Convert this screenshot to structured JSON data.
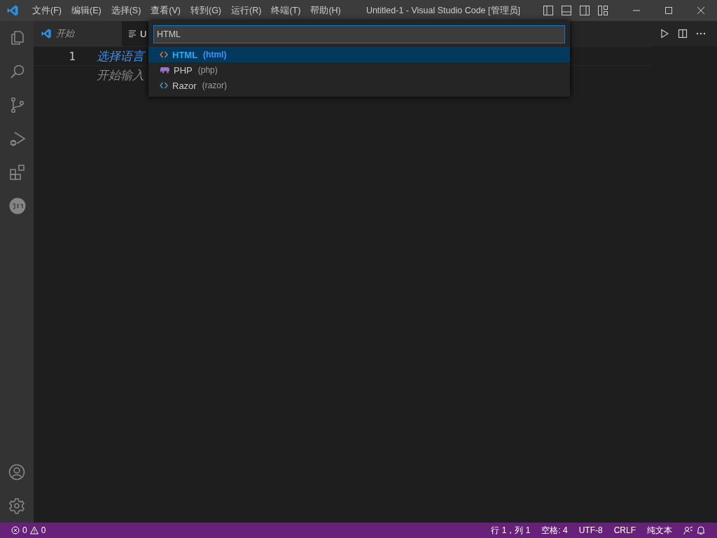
{
  "window": {
    "title": "Untitled-1 - Visual Studio Code [管理员]"
  },
  "menu": [
    "文件(F)",
    "编辑(E)",
    "选择(S)",
    "查看(V)",
    "转到(G)",
    "运行(R)",
    "终端(T)",
    "帮助(H)"
  ],
  "activity_bar": [
    {
      "kind": "explorer",
      "selected": false
    },
    {
      "kind": "search",
      "selected": false
    },
    {
      "kind": "source-control",
      "selected": false
    },
    {
      "kind": "debug",
      "selected": false
    },
    {
      "kind": "extensions",
      "selected": false
    },
    {
      "kind": "json",
      "selected": false
    }
  ],
  "tabs": [
    {
      "label": "开始",
      "kind": "welcome",
      "selected": false
    },
    {
      "label": "U",
      "kind": "file",
      "selected": true
    }
  ],
  "editor": {
    "lines": [
      {
        "number": "1",
        "text": "选择语言",
        "kind": "hint"
      },
      {
        "text": "开始输入",
        "kind": "muted"
      }
    ]
  },
  "quick_pick": {
    "value": "HTML",
    "items": [
      {
        "label": "HTML",
        "id": "(html)",
        "kind": "html",
        "selected": true
      },
      {
        "label": "PHP",
        "id": "(php)",
        "kind": "php",
        "selected": false
      },
      {
        "label": "Razor",
        "id": "(razor)",
        "kind": "razor",
        "selected": false
      }
    ]
  },
  "status_bar": {
    "errors": "0",
    "warnings": "0",
    "right": [
      "行 1，列 1",
      "空格: 4",
      "UTF-8",
      "CRLF",
      "纯文本"
    ]
  }
}
